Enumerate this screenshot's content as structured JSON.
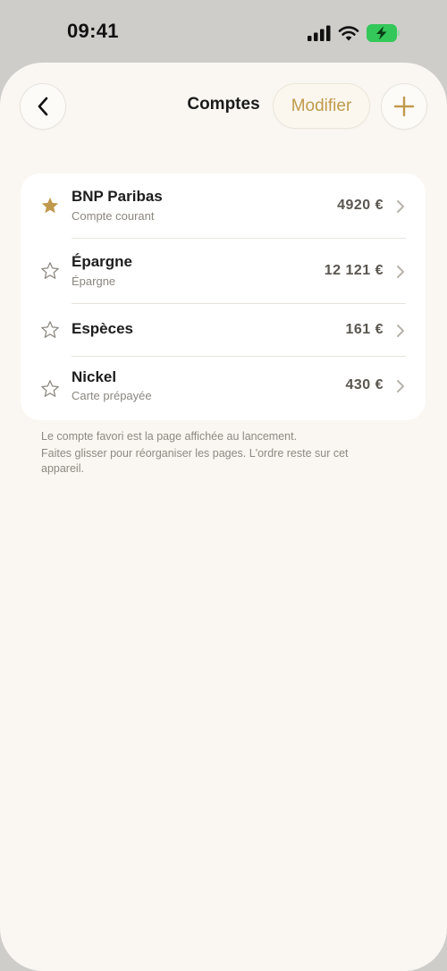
{
  "status_bar": {
    "time": "09:41",
    "icons": [
      "cellular-signal-icon",
      "wifi-icon",
      "battery-charging-icon"
    ]
  },
  "nav": {
    "title": "Comptes",
    "edit_label": "Modifier",
    "back_icon": "chevron-left-icon",
    "add_icon": "plus-icon"
  },
  "accounts": [
    {
      "name": "BNP Paribas",
      "subtitle": "Compte courant",
      "amount": "4920 €",
      "favorite": true
    },
    {
      "name": "Épargne",
      "subtitle": "Épargne",
      "amount": "12 121 €",
      "favorite": false
    },
    {
      "name": "Espèces",
      "subtitle": "",
      "amount": "161 €",
      "favorite": false
    },
    {
      "name": "Nickel",
      "subtitle": "Carte prépayée",
      "amount": "430 €",
      "favorite": false
    }
  ],
  "footer": {
    "line1": "Le compte favori est la page affichée au lancement.",
    "line2": "Faites glisser pour réorganiser les pages. L'ordre reste sur cet appareil."
  },
  "colors": {
    "accent": "#C09A4C",
    "background": "#FAF7F2",
    "card": "#FFFFFF",
    "battery": "#34C759"
  }
}
